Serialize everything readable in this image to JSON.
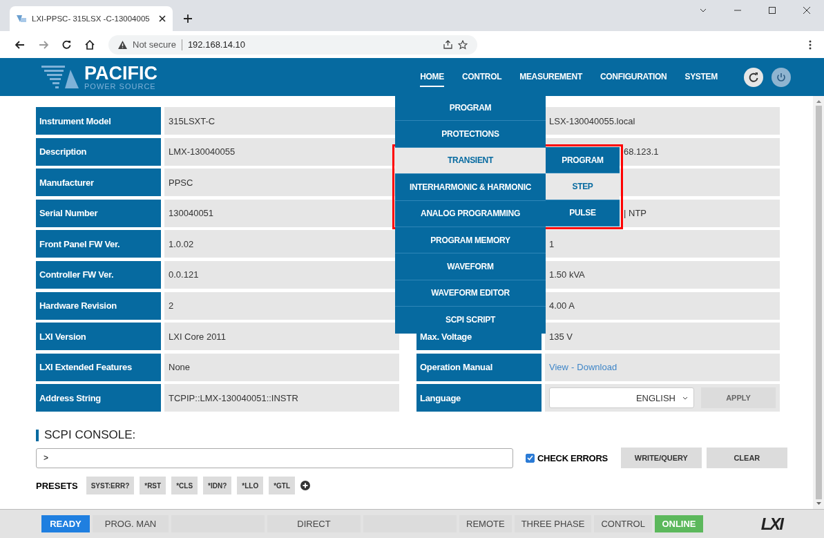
{
  "browser": {
    "tab_title": "LXI-PPSC- 315LSX -C-13004005",
    "security": "Not secure",
    "address": "192.168.14.10"
  },
  "header": {
    "logo_title": "PACIFIC",
    "logo_subtitle": "POWER SOURCE",
    "nav": [
      {
        "label": "HOME",
        "selected": true
      },
      {
        "label": "CONTROL",
        "selected": false
      },
      {
        "label": "MEASUREMENT",
        "selected": false
      },
      {
        "label": "CONFIGURATION",
        "selected": false
      },
      {
        "label": "SYSTEM",
        "selected": false
      }
    ]
  },
  "info_left": [
    {
      "label": "Instrument Model",
      "value": "315LSXT-C"
    },
    {
      "label": "Description",
      "value": "LMX-130040055"
    },
    {
      "label": "Manufacturer",
      "value": "PPSC"
    },
    {
      "label": "Serial Number",
      "value": "130040051"
    },
    {
      "label": "Front Panel FW Ver.",
      "value": "1.0.02"
    },
    {
      "label": "Controller FW Ver.",
      "value": "0.0.121"
    },
    {
      "label": "Hardware Revision",
      "value": "2"
    },
    {
      "label": "LXI Version",
      "value": "LXI Core 2011"
    },
    {
      "label": "LXI Extended Features",
      "value": "None"
    },
    {
      "label": "Address String",
      "value": "TCPIP::LMX-130040051::INSTR"
    }
  ],
  "info_right": [
    {
      "kind": "text",
      "value": "LSX-130040055.local"
    },
    {
      "kind": "clipped",
      "value": "68.123.1"
    },
    {
      "kind": "text"
    },
    {
      "kind": "clipped",
      "value": "| NTP"
    },
    {
      "kind": "text",
      "value": "1"
    },
    {
      "kind": "text",
      "value": "1.50 kVA"
    },
    {
      "kind": "text",
      "value": "4.00 A"
    },
    {
      "kind": "text",
      "label": "Max. Voltage",
      "value": "135 V"
    },
    {
      "kind": "links",
      "label": "Operation Manual",
      "links": [
        "View",
        "Download"
      ],
      "separator": "-"
    },
    {
      "kind": "language",
      "label": "Language",
      "value": "ENGLISH",
      "button": "APPLY"
    }
  ],
  "menu": [
    {
      "label": "PROGRAM",
      "highlighted": false
    },
    {
      "label": "PROTECTIONS",
      "highlighted": false
    },
    {
      "label": "TRANSIENT",
      "highlighted": true
    },
    {
      "label": "INTERHARMONIC & HARMONIC",
      "highlighted": false
    },
    {
      "label": "ANALOG PROGRAMMING",
      "highlighted": false
    },
    {
      "label": "PROGRAM MEMORY",
      "highlighted": false
    },
    {
      "label": "WAVEFORM",
      "highlighted": false
    },
    {
      "label": "WAVEFORM EDITOR",
      "highlighted": false
    },
    {
      "label": "SCPI SCRIPT",
      "highlighted": false
    }
  ],
  "submenu": [
    {
      "label": "PROGRAM",
      "highlighted": false
    },
    {
      "label": "STEP",
      "highlighted": true
    },
    {
      "label": "PULSE",
      "highlighted": false
    }
  ],
  "console": {
    "title": "SCPI CONSOLE:",
    "prompt": ">",
    "check_errors": {
      "label": "CHECK ERRORS",
      "checked": true
    },
    "buttons": [
      "WRITE/QUERY",
      "CLEAR"
    ],
    "presets_label": "PRESETS",
    "presets": [
      "SYST:ERR?",
      "*RST",
      "*CLS",
      "*IDN?",
      "*LLO",
      "*GTL"
    ]
  },
  "status_bar": [
    {
      "label": "READY",
      "color": "#1f7fe0"
    },
    {
      "label": "PROG. MAN",
      "color": "#dcdcdc"
    },
    {
      "color": "#dcdcdc"
    },
    {
      "label": "DIRECT",
      "color": "#dcdcdc"
    },
    {
      "color": "#dcdcdc"
    },
    {
      "label": "REMOTE",
      "color": "#dcdcdc"
    },
    {
      "label": "THREE PHASE",
      "color": "#dcdcdc"
    },
    {
      "label": "CONTROL",
      "color": "#dcdcdc"
    },
    {
      "label": "ONLINE",
      "color": "#5cb85c"
    }
  ],
  "status_logo": "LXI"
}
